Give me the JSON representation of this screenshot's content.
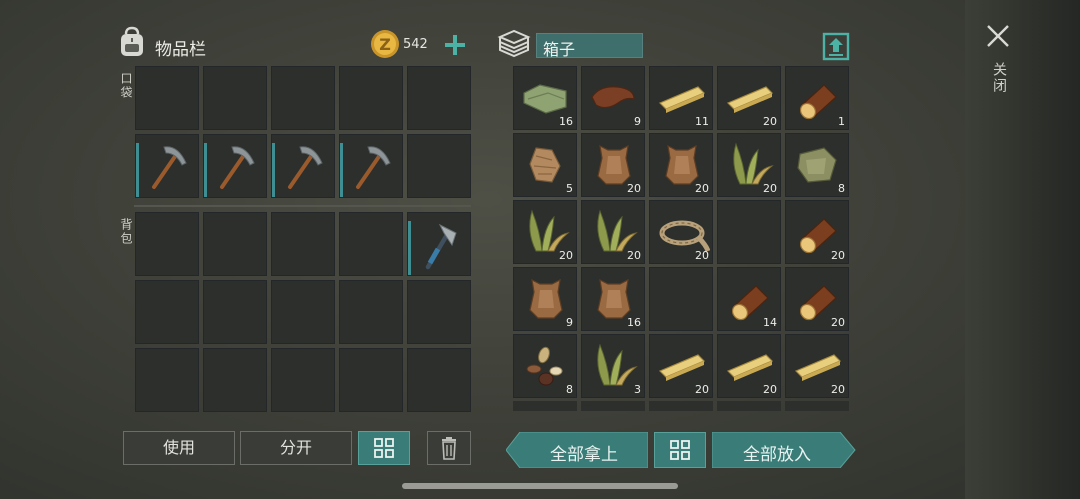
{
  "inventory": {
    "title": "物品栏",
    "coins": "542",
    "pocket_label": "口袋",
    "backpack_label": "背包",
    "pocket_slots": [
      {
        "item": "",
        "qty": ""
      },
      {
        "item": "",
        "qty": ""
      },
      {
        "item": "",
        "qty": ""
      },
      {
        "item": "",
        "qty": ""
      },
      {
        "item": "",
        "qty": ""
      },
      {
        "item": "pickaxe",
        "qty": ""
      },
      {
        "item": "pickaxe",
        "qty": ""
      },
      {
        "item": "pickaxe",
        "qty": ""
      },
      {
        "item": "pickaxe",
        "qty": ""
      },
      {
        "item": "",
        "qty": ""
      }
    ],
    "backpack_slots": [
      {
        "item": "",
        "qty": ""
      },
      {
        "item": "",
        "qty": ""
      },
      {
        "item": "",
        "qty": ""
      },
      {
        "item": "",
        "qty": ""
      },
      {
        "item": "hatchet",
        "qty": ""
      },
      {
        "item": "",
        "qty": ""
      },
      {
        "item": "",
        "qty": ""
      },
      {
        "item": "",
        "qty": ""
      },
      {
        "item": "",
        "qty": ""
      },
      {
        "item": "",
        "qty": ""
      },
      {
        "item": "",
        "qty": ""
      },
      {
        "item": "",
        "qty": ""
      },
      {
        "item": "",
        "qty": ""
      },
      {
        "item": "",
        "qty": ""
      },
      {
        "item": "",
        "qty": ""
      }
    ],
    "buttons": {
      "use": "使用",
      "split": "分开"
    }
  },
  "box": {
    "title": "箱子",
    "slots": [
      {
        "item": "cloth",
        "qty": "16"
      },
      {
        "item": "leather",
        "qty": "9"
      },
      {
        "item": "plank",
        "qty": "11"
      },
      {
        "item": "plank",
        "qty": "20"
      },
      {
        "item": "log",
        "qty": "1"
      },
      {
        "item": "fur",
        "qty": "5"
      },
      {
        "item": "hide",
        "qty": "20"
      },
      {
        "item": "hide",
        "qty": "20"
      },
      {
        "item": "plant-fiber",
        "qty": "20"
      },
      {
        "item": "cloth-scrap",
        "qty": "8"
      },
      {
        "item": "plant-fiber",
        "qty": "20"
      },
      {
        "item": "plant-fiber",
        "qty": "20"
      },
      {
        "item": "rope",
        "qty": "20"
      },
      {
        "item": "",
        "qty": ""
      },
      {
        "item": "log",
        "qty": "20"
      },
      {
        "item": "hide",
        "qty": "9"
      },
      {
        "item": "hide",
        "qty": "16"
      },
      {
        "item": "",
        "qty": ""
      },
      {
        "item": "log",
        "qty": "14"
      },
      {
        "item": "log",
        "qty": "20"
      },
      {
        "item": "seeds",
        "qty": "8"
      },
      {
        "item": "plant-fiber",
        "qty": "3"
      },
      {
        "item": "plank",
        "qty": "20"
      },
      {
        "item": "plank",
        "qty": "20"
      },
      {
        "item": "plank",
        "qty": "20"
      }
    ],
    "buttons": {
      "take_all": "全部拿上",
      "put_all": "全部放入"
    }
  },
  "close_label": "关闭",
  "colors": {
    "accent": "#3a7c77",
    "slot_bg": "#2c2f2c",
    "coin": "#e3b13c"
  }
}
